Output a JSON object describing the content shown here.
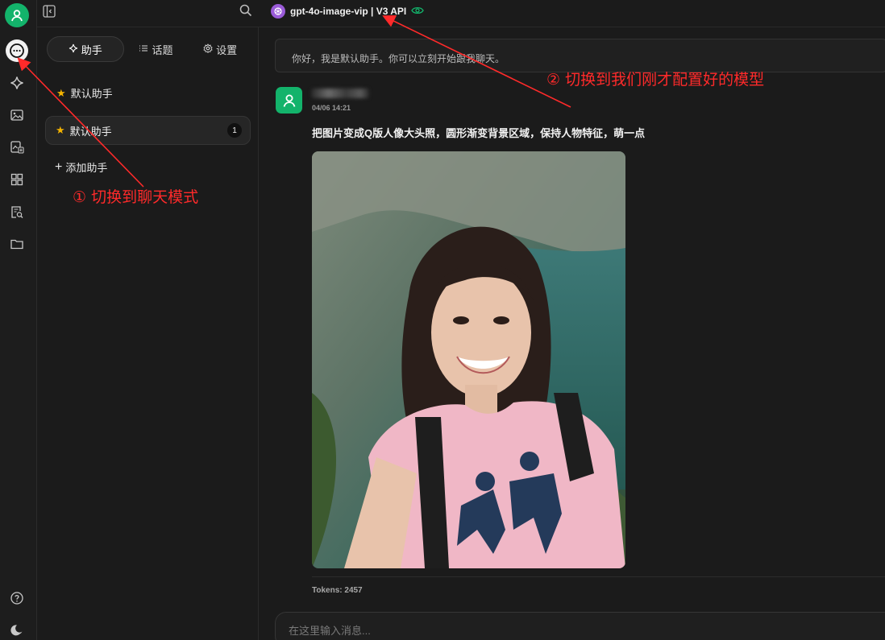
{
  "topbar": {
    "model_name": "gpt-4o-image-vip | V3 API"
  },
  "rail": {
    "icons": [
      "user-avatar-icon",
      "chat-icon",
      "sparkle-icon",
      "image-icon",
      "image-translate-icon",
      "apps-grid-icon",
      "document-search-icon",
      "folder-icon",
      "help-icon",
      "moon-icon"
    ]
  },
  "panel": {
    "tabs": [
      {
        "label": "助手",
        "icon": "sparkle-icon"
      },
      {
        "label": "话题",
        "icon": "list-icon"
      },
      {
        "label": "设置",
        "icon": "gear-icon"
      }
    ],
    "items": [
      {
        "label": "默认助手"
      },
      {
        "label": "默认助手",
        "count": "1"
      }
    ],
    "add_label": "添加助手"
  },
  "chat": {
    "greeting": "你好，我是默认助手。你可以立刻开始跟我聊天。",
    "message": {
      "time": "04/06 14:21",
      "text": "把图片变成Q版人像大头照，圆形渐变背景区域，保持人物特征，萌一点",
      "tokens": "Tokens: 2457"
    },
    "input_placeholder": "在这里输入消息..."
  },
  "annotations": {
    "a1": "① 切换到聊天模式",
    "a2": "② 切换到我们刚才配置好的模型"
  },
  "colors": {
    "accent_green": "#13b36b",
    "annotation_red": "#ff2a2a",
    "model_logo": "#9a5bd8"
  }
}
